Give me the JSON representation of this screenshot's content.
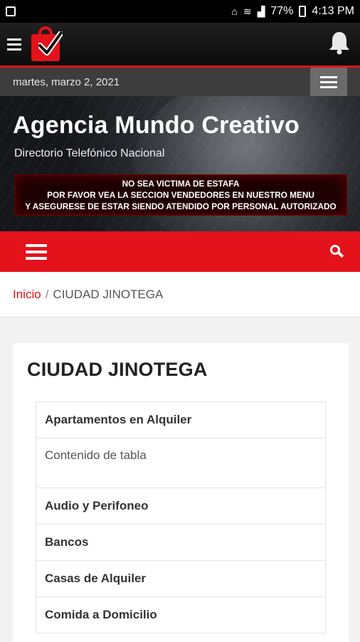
{
  "status_bar": {
    "battery": "77%",
    "time": "4:13 PM",
    "icons": [
      "image-icon",
      "notification-icon",
      "wifi-icon",
      "signal-icon",
      "battery-icon"
    ]
  },
  "app_bar": {
    "logo": "shopping-bag-check-logo",
    "bell_icon": "bell-icon"
  },
  "date_bar": {
    "date": "martes, marzo 2, 2021"
  },
  "hero": {
    "title": "Agencia Mundo Creativo",
    "subtitle": "Directorio Telefónico Nacional",
    "notice_lines": [
      "NO SEA VICTIMA DE ESTAFA",
      "POR FAVOR VEA LA SECCION VENDEDORES EN NUESTRO MENU",
      "Y ASEGURESE DE ESTAR SIENDO ATENDIDO POR PERSONAL AUTORIZADO"
    ]
  },
  "nav": {
    "menu_icon": "hamburger-icon",
    "search_icon": "search-icon"
  },
  "breadcrumb": {
    "home": "Inicio",
    "separator": "/",
    "current": "CIUDAD JINOTEGA"
  },
  "page": {
    "title": "CIUDAD JINOTEGA",
    "items": [
      {
        "label": "Apartamentos en Alquiler",
        "body": "Contenido de tabla"
      },
      {
        "label": "Audio y Perifoneo"
      },
      {
        "label": "Bancos"
      },
      {
        "label": "Casas de Alquiler"
      },
      {
        "label": "Comida a Domicilio"
      }
    ]
  },
  "colors": {
    "accent_red": "#e3121b",
    "dark_bar": "#3d3d3d",
    "hero_dark": "#15171a"
  }
}
